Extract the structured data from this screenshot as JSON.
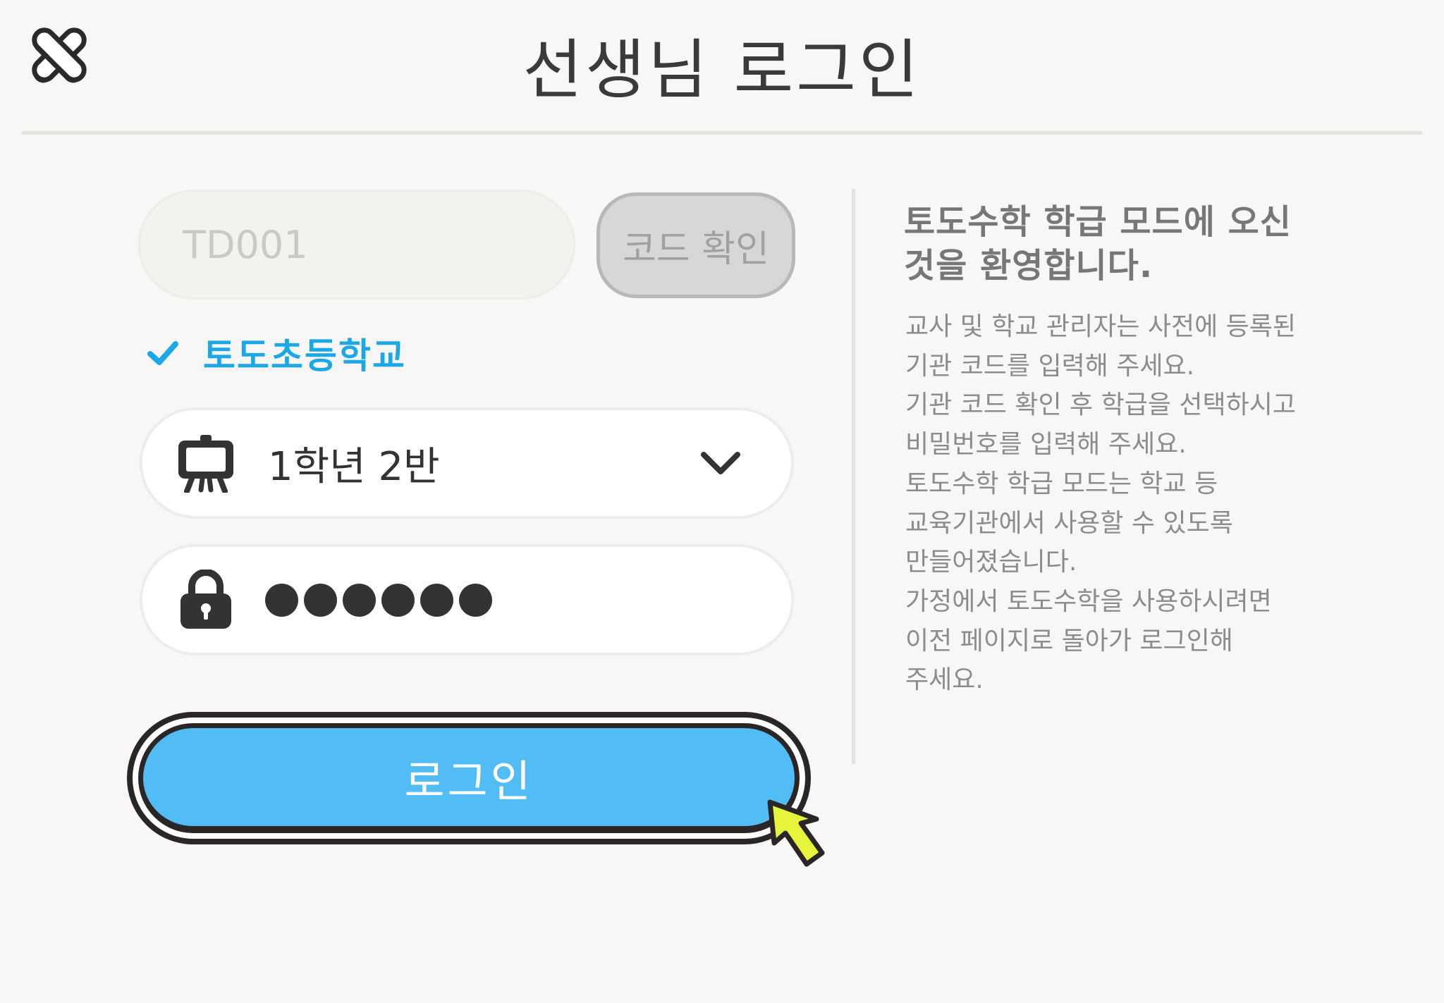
{
  "header": {
    "title": "선생님 로그인",
    "close_icon": "close-icon"
  },
  "code": {
    "value": "TD001",
    "confirm_label": "코드 확인"
  },
  "school": {
    "verified_icon": "check-icon",
    "name": "토도초등학교"
  },
  "class_select": {
    "icon": "blackboard-icon",
    "value": "1학년 2반",
    "dropdown_icon": "chevron-down-icon"
  },
  "password": {
    "icon": "lock-icon",
    "masked_length": 6
  },
  "info": {
    "title": "토도수학 학급 모드에 오신 것을 환영합니다.",
    "lines": [
      "교사 및 학교 관리자는 사전에 등록된",
      "기관 코드를 입력해 주세요.",
      "기관 코드 확인 후 학급을 선택하시고",
      "비밀번호를 입력해 주세요.",
      "토도수학 학급 모드는 학교 등",
      "교육기관에서 사용할 수 있도록",
      "만들어졌습니다.",
      "가정에서 토도수학을 사용하시려면",
      "이전 페이지로 돌아가 로그인해",
      "주세요."
    ]
  },
  "login": {
    "label": "로그인"
  },
  "colors": {
    "accent_blue": "#52bdf4",
    "school_blue": "#1ba7e8",
    "cursor_yellow": "#e6f53c",
    "background": "#f8f7f5"
  }
}
